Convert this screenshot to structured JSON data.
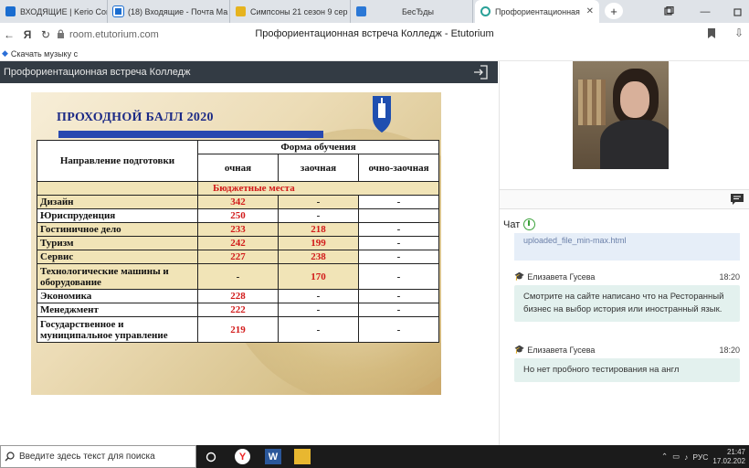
{
  "browser": {
    "tabs": [
      {
        "label": "ВХОДЯЩИЕ | Kerio Conne",
        "color": "#1a6dd0"
      },
      {
        "label": "(18) Входящие - Почта Ма",
        "color": "#1a6dd0"
      },
      {
        "label": "Симпсоны 21 сезон 9 сер",
        "color": "#e6b31e"
      },
      {
        "label": "БесЂды",
        "color": "#2b78d6"
      },
      {
        "label": "Профориентационная",
        "color": "#2aa198",
        "close": "✕"
      }
    ],
    "new_tab": "+",
    "url": "room.etutorium.com",
    "page_title": "Профориентационная встреча Колледж - Etutorium",
    "bookmark": "Скачать музыку с"
  },
  "presentation": {
    "header": "Профориентационная встреча Колледж",
    "slide": {
      "title": "ПРОХОДНОЙ БАЛЛ 2020",
      "col_direction": "Направление подготовки",
      "col_form": "Форма обучения",
      "col_fulltime": "очная",
      "col_extramural": "заочная",
      "col_mixed": "очно-заочная",
      "section": "Бюджетные места",
      "rows": [
        {
          "name": "Дизайн",
          "full": "342",
          "extra": "-",
          "mixed": "-",
          "alt": true
        },
        {
          "name": "Юриспруденция",
          "full": "250",
          "extra": "-",
          "mixed": "",
          "alt": false
        },
        {
          "name": "Гостиничное дело",
          "full": "233",
          "extra": "218",
          "mixed": "-",
          "alt": true
        },
        {
          "name": "Туризм",
          "full": "242",
          "extra": "199",
          "mixed": "-",
          "alt": true
        },
        {
          "name": "Сервис",
          "full": "227",
          "extra": "238",
          "mixed": "-",
          "alt": true
        },
        {
          "name": "Технологические машины и оборудование",
          "full": "-",
          "extra": "170",
          "mixed": "-",
          "alt": true
        },
        {
          "name": "Экономика",
          "full": "228",
          "extra": "-",
          "mixed": "-",
          "alt": false
        },
        {
          "name": "Менеджмент",
          "full": "222",
          "extra": "-",
          "mixed": "-",
          "alt": false
        },
        {
          "name": "Государственное и муниципальное управление",
          "full": "219",
          "extra": "-",
          "mixed": "-",
          "alt": false
        }
      ]
    }
  },
  "chat": {
    "label": "Чат",
    "prev_fragment": "uploaded_file_min-max.html",
    "messages": [
      {
        "author": "Елизавета Гусева",
        "time": "18:20",
        "text": "Смотрите на сайте написано что на Ресторанный бизнес на выбор история или иностранный язык."
      },
      {
        "author": "Елизавета Гусева",
        "time": "18:20",
        "text": "Но нет пробного тестирования на англ"
      }
    ]
  },
  "taskbar": {
    "search_placeholder": "Введите здесь текст для поиска",
    "lang": "РУС",
    "time": "21:47",
    "date": "17.02.202"
  }
}
